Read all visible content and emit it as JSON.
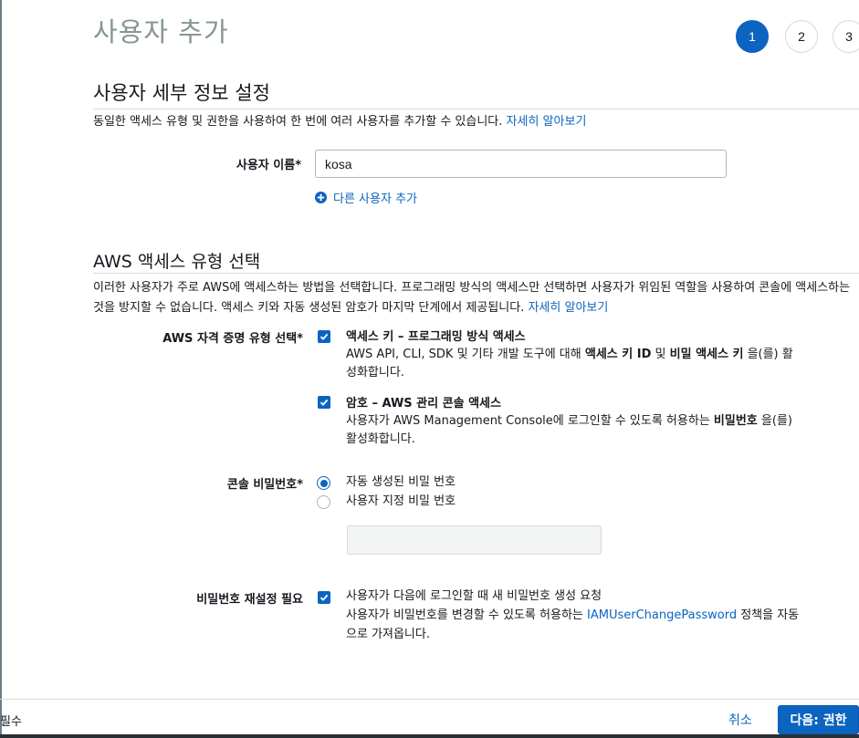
{
  "page": {
    "title": "사용자 추가"
  },
  "steps": [
    "1",
    "2",
    "3"
  ],
  "details": {
    "title": "사용자 세부 정보 설정",
    "description": "동일한 액세스 유형 및 권한을 사용하여 한 번에 여러 사용자를 추가할 수 있습니다.",
    "learn_more": "자세히 알아보기",
    "username_label": "사용자 이름*",
    "username_value": "kosa",
    "add_user": "다른 사용자 추가"
  },
  "access": {
    "title": "AWS 액세스 유형 선택",
    "description_line1": "이러한 사용자가 주로 AWS에 액세스하는 방법을 선택합니다. 프로그래밍 방식의 액세스만 선택하면 사용자가 위임된 역할을 사용하여 콘솔에 액세스하는",
    "description_line2": "것을 방지할 수 없습니다. 액세스 키와 자동 생성된 암호가 마지막 단계에서 제공됩니다.",
    "learn_more": "자세히 알아보기",
    "credential_label": "AWS 자격 증명 유형 선택*",
    "option1": {
      "title": "액세스 키 – 프로그래밍 방식 액세스",
      "line1_pre": "AWS API, CLI, SDK 및 기타 개발 도구에 대해 ",
      "line1_bold1": "액세스 키 ID",
      "line1_mid": " 및 ",
      "line1_bold2": "비밀 액세스 키",
      "line1_post": " 을(를) 활",
      "line2": "성화합니다."
    },
    "option2": {
      "title": "암호 – AWS 관리 콘솔 액세스",
      "line1_pre": "사용자가 AWS Management Console에 로그인할 수 있도록 허용하는 ",
      "line1_bold": "비밀번호",
      "line1_post": " 을(를)",
      "line2": "활성화합니다."
    }
  },
  "password": {
    "label": "콘솔 비밀번호*",
    "auto": "자동 생성된 비밀 번호",
    "custom": "사용자 지정 비밀 번호"
  },
  "reset": {
    "label": "비밀번호 재설정 필요",
    "text": "사용자가 다음에 로그인할 때 새 비밀번호 생성 요청",
    "line2_pre": "사용자가 비밀번호를 변경할 수 있도록 허용하는 ",
    "policy": "IAMUserChangePassword",
    "line2_post": " 정책을 자동",
    "line3": "으로 가져옵니다."
  },
  "footer": {
    "required": "필수",
    "cancel": "취소",
    "next": "다음: 권한"
  },
  "colors": {
    "accent": "#0b64c0",
    "title_gray": "#879596"
  }
}
